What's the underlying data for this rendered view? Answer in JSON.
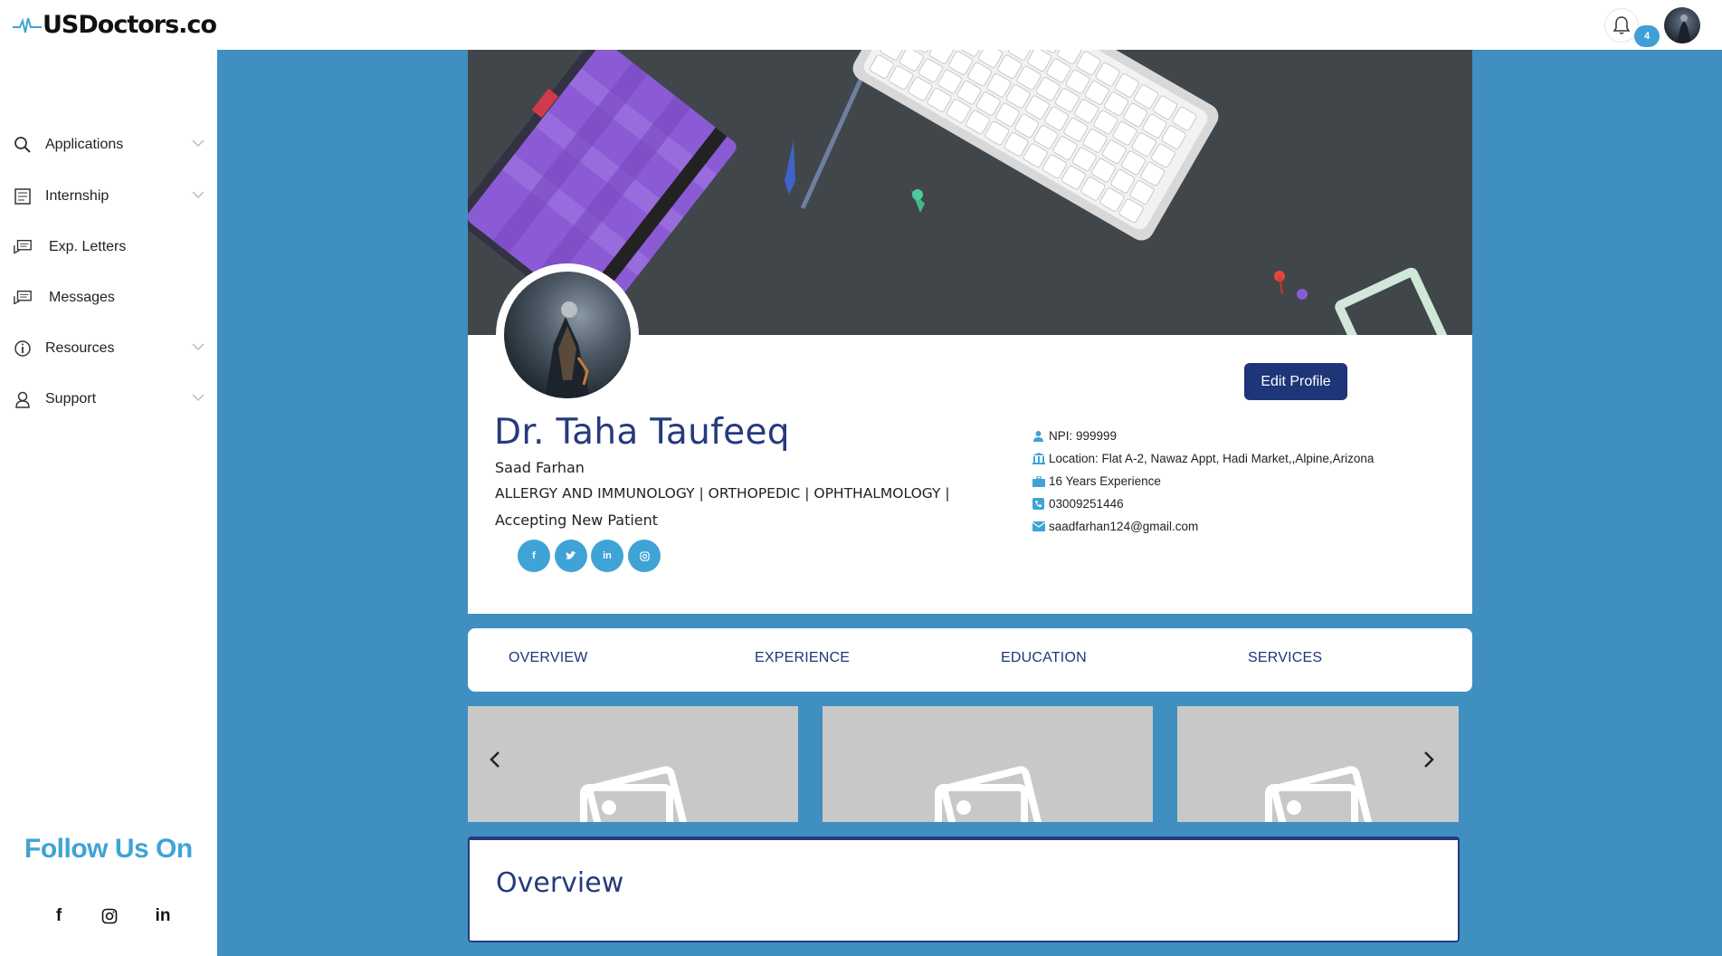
{
  "brand": {
    "name": "USDoctors.co"
  },
  "header": {
    "notification_count": "4"
  },
  "sidebar": {
    "items": [
      {
        "label": "Applications",
        "icon": "search-icon",
        "has_chevron": true
      },
      {
        "label": "Internship",
        "icon": "document-icon",
        "has_chevron": true
      },
      {
        "label": "Exp. Letters",
        "icon": "letters-icon",
        "has_chevron": false
      },
      {
        "label": "Messages",
        "icon": "messages-icon",
        "has_chevron": false
      },
      {
        "label": "Resources",
        "icon": "info-icon",
        "has_chevron": true
      },
      {
        "label": "Support",
        "icon": "support-icon",
        "has_chevron": true
      }
    ],
    "follow_title": "Follow Us On",
    "social": [
      "facebook-icon",
      "instagram-icon",
      "linkedin-icon"
    ]
  },
  "profile": {
    "name": "Dr. Taha Taufeeq",
    "username": "Saad Farhan",
    "specialties": "ALLERGY AND IMMUNOLOGY | ORTHOPEDIC | OPHTHALMOLOGY |",
    "status": "Accepting New Patient",
    "edit_label": "Edit Profile",
    "social": [
      "facebook-icon",
      "twitter-icon",
      "linkedin-icon",
      "instagram-icon"
    ],
    "details": {
      "npi": "NPI: 999999",
      "location": "Location: Flat A-2, Nawaz Appt, Hadi Market,,Alpine,Arizona",
      "experience": "16 Years Experience",
      "phone": "03009251446",
      "email": "saadfarhan124@gmail.com"
    }
  },
  "tabs": [
    {
      "label": "OVERVIEW"
    },
    {
      "label": "EXPERIENCE"
    },
    {
      "label": "EDUCATION"
    },
    {
      "label": "SERVICES"
    }
  ],
  "overview": {
    "title": "Overview"
  },
  "colors": {
    "primary": "#1f3579",
    "accent": "#3fa3d6",
    "background": "#3f8fc0"
  }
}
